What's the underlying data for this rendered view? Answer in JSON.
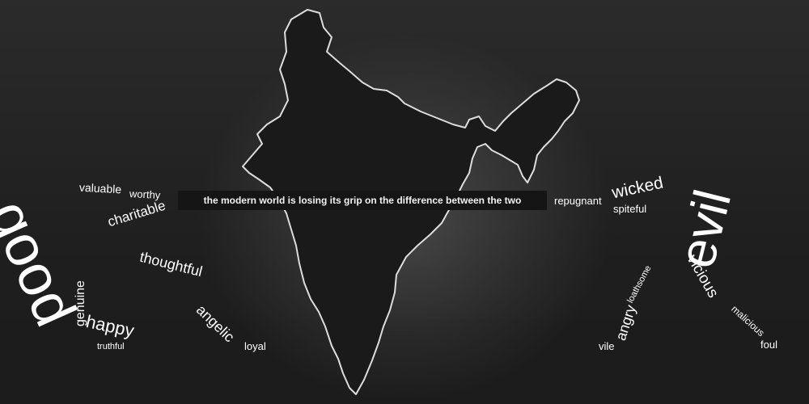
{
  "caption": "the modern world is losing its grip on the difference between the two",
  "good_cloud": {
    "title": "good",
    "words": [
      "valuable",
      "worthy",
      "charitable",
      "thoughtful",
      "angelic",
      "genuine",
      "happy",
      "truthful",
      "loyal"
    ]
  },
  "evil_cloud": {
    "title": "evil",
    "words": [
      "repugnant",
      "wicked",
      "spiteful",
      "vicious",
      "malicious",
      "angry",
      "loathsome",
      "vile",
      "foul"
    ]
  },
  "colors": {
    "background": "#222222",
    "map_fill": "#1a1a1a",
    "map_stroke": "#dddddd",
    "text": "#ffffff"
  }
}
